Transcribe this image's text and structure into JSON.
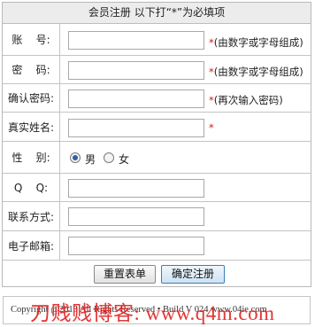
{
  "header": {
    "title": "会员注册  以下打“*”为必填项"
  },
  "form": {
    "account": {
      "label": "账    号:",
      "value": "",
      "star": "*",
      "hint": "(由数字或字母组成)"
    },
    "password": {
      "label": "密    码:",
      "value": "",
      "star": "*",
      "hint": "(由数字或字母组成)"
    },
    "confirm": {
      "label": "确认密码:",
      "value": "",
      "star": "*",
      "hint": "(再次输入密码)"
    },
    "realname": {
      "label": "真实姓名:",
      "value": "",
      "star": "*"
    },
    "gender": {
      "label": "性    别:",
      "options": [
        "男",
        "女"
      ],
      "selected": "男"
    },
    "qq": {
      "label": "Q    Q:",
      "value": ""
    },
    "phone": {
      "label": "联系方式:",
      "value": ""
    },
    "email": {
      "label": "电子邮箱:",
      "value": ""
    }
  },
  "buttons": {
    "reset": "重置表单",
    "submit": "确定注册"
  },
  "footer": {
    "copyright": "Copyright @2013  All Rights Reserved • Build V 024 www.04ie.com"
  },
  "watermark": {
    "text": "刀贱贱博客: www.q4m.com"
  },
  "colors": {
    "required_star": "#d21a1a",
    "header_bg": "#ececec",
    "watermark": "#e21f1f"
  }
}
